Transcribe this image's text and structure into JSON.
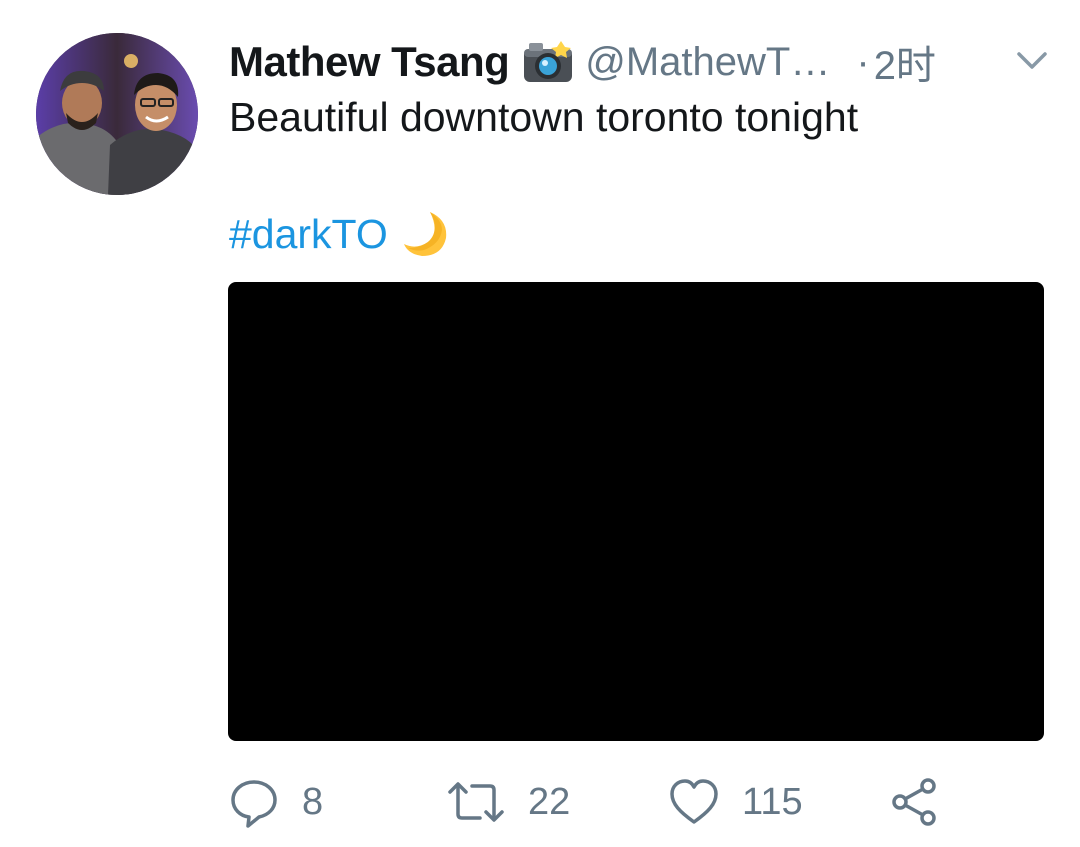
{
  "tweet": {
    "display_name": "Mathew Tsang",
    "handle": "@MathewT…",
    "separator": "·",
    "timestamp": "2时",
    "text": "Beautiful downtown toronto tonight",
    "hashtag": "#darkTO",
    "icons": {
      "name_badge": "camera-with-flash-icon",
      "hashtag_emoji": "crescent-moon-icon",
      "menu": "chevron-down-icon"
    }
  },
  "actions": {
    "reply_count": "8",
    "retweet_count": "22",
    "like_count": "115",
    "icons": [
      "reply-icon",
      "retweet-icon",
      "like-icon",
      "share-icon"
    ]
  },
  "colors": {
    "text": "#14171a",
    "secondary": "#657786",
    "link": "#1b95e0",
    "media_background": "#000000",
    "moon": "#ffc33b"
  }
}
